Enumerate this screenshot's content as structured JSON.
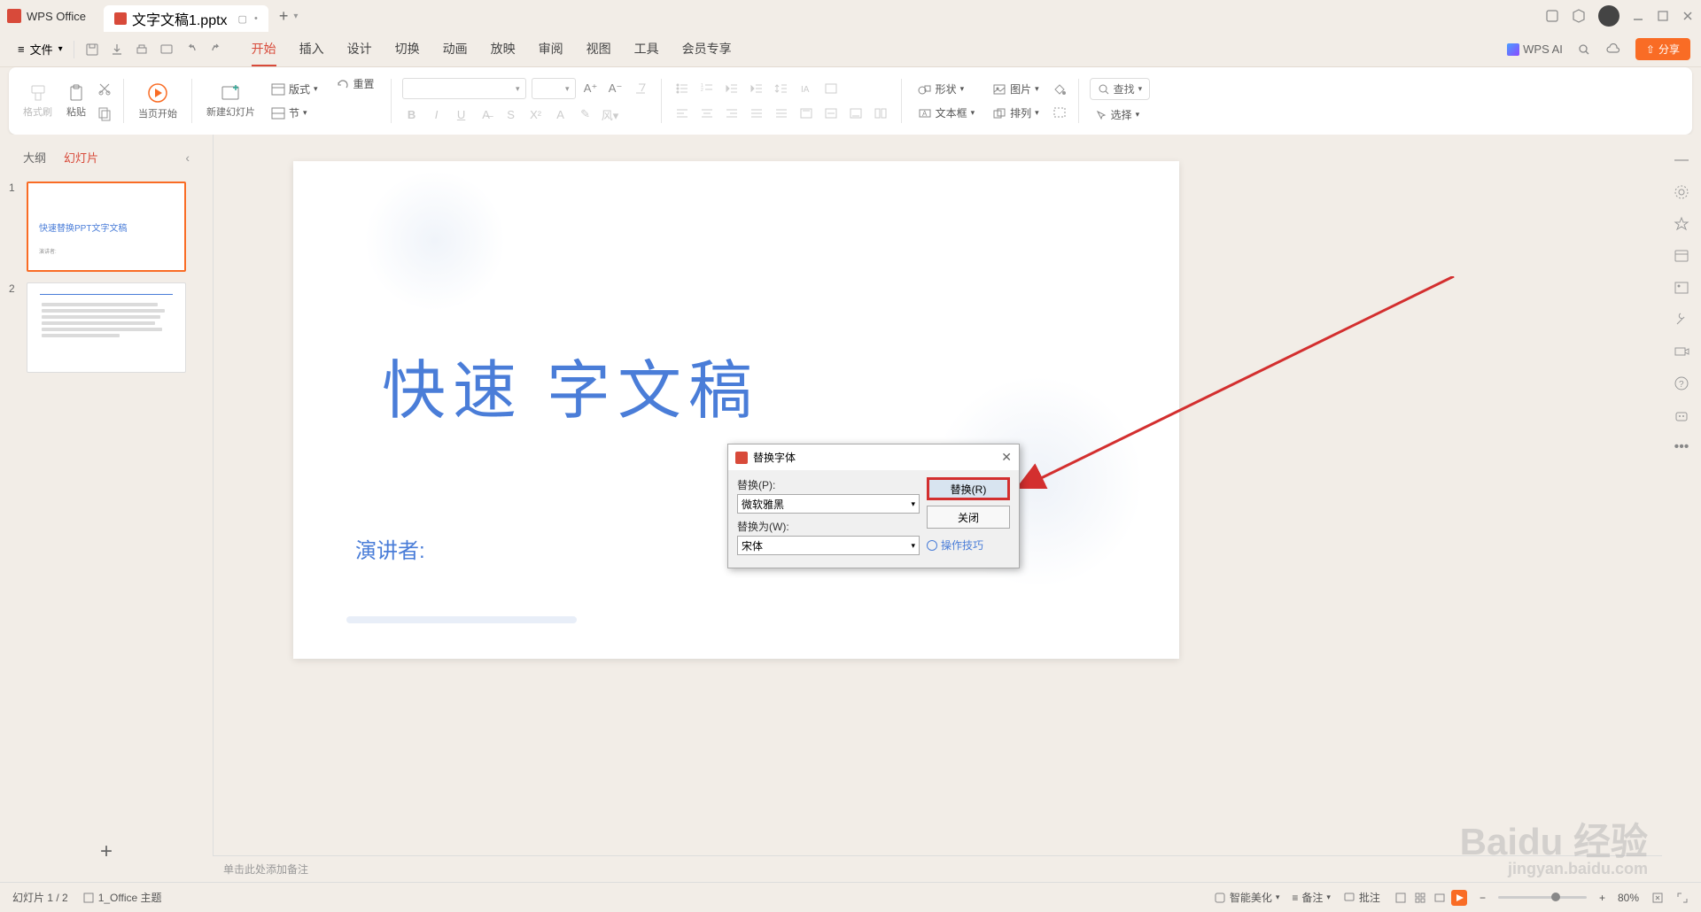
{
  "app": {
    "name": "WPS Office"
  },
  "doc": {
    "tab_name": "文字文稿1.pptx"
  },
  "menu": {
    "file": "文件",
    "tabs": [
      "开始",
      "插入",
      "设计",
      "切换",
      "动画",
      "放映",
      "审阅",
      "视图",
      "工具",
      "会员专享"
    ],
    "active_index": 0,
    "wps_ai": "WPS AI",
    "share": "分享"
  },
  "ribbon": {
    "format_painter": "格式刷",
    "paste": "粘贴",
    "start_from_current": "当页开始",
    "new_slide": "新建幻灯片",
    "layout": "版式",
    "section": "节",
    "reset": "重置",
    "shape": "形状",
    "picture": "图片",
    "textbox": "文本框",
    "arrange": "排列",
    "find": "查找",
    "select": "选择"
  },
  "side": {
    "tab_outline": "大纲",
    "tab_slides": "幻灯片",
    "slides": [
      {
        "num": "1",
        "title": "快速替换PPT文字文稿",
        "sub": "演讲者:"
      },
      {
        "num": "2"
      }
    ]
  },
  "slide": {
    "title": "快速    字文稿",
    "subtitle": "演讲者:"
  },
  "dialog": {
    "title": "替换字体",
    "replace_label": "替换(P):",
    "replace_value": "微软雅黑",
    "with_label": "替换为(W):",
    "with_value": "宋体",
    "btn_replace": "替换(R)",
    "btn_close": "关闭",
    "tips": "操作技巧"
  },
  "notes": {
    "placeholder": "单击此处添加备注"
  },
  "status": {
    "slide_count": "幻灯片 1 / 2",
    "theme": "1_Office 主题",
    "beautify": "智能美化",
    "notes": "备注",
    "comments": "批注",
    "zoom": "80%"
  },
  "watermark": {
    "main": "Baidu 经验",
    "sub": "jingyan.baidu.com"
  }
}
